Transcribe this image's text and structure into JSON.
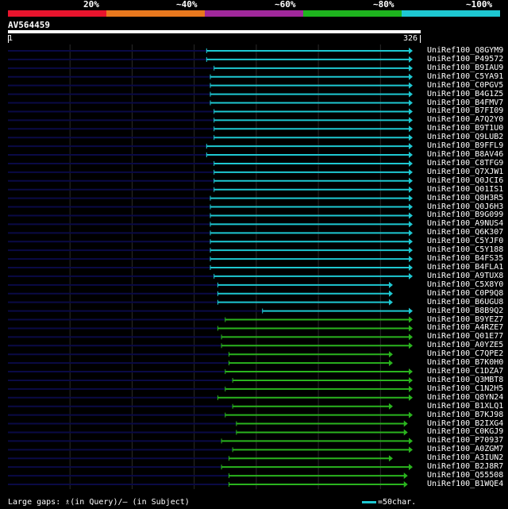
{
  "legend": {
    "segments": [
      {
        "color": "#e8142d",
        "label": "20%"
      },
      {
        "color": "#e8781e",
        "label": "~40%"
      },
      {
        "color": "#a0289b",
        "label": "~60%"
      },
      {
        "color": "#1eb41e",
        "label": "~80%"
      },
      {
        "color": "#1ec8d2",
        "label": "~100%"
      }
    ]
  },
  "query": {
    "name": "AV564459",
    "start": "1",
    "end": "326",
    "length": 326
  },
  "colors": {
    "cyan": "#1ec8d2",
    "green": "#2ab41e",
    "gap_line": "#0a0a46",
    "grid": "#2a2a2a"
  },
  "hits": [
    {
      "id": "UniRef100_Q8GYM9",
      "start": 160,
      "end": 326,
      "color": "cyan"
    },
    {
      "id": "UniRef100_P49572",
      "start": 160,
      "end": 326,
      "color": "cyan"
    },
    {
      "id": "UniRef100_B9IAU9",
      "start": 166,
      "end": 326,
      "color": "cyan"
    },
    {
      "id": "UniRef100_C5YA91",
      "start": 163,
      "end": 326,
      "color": "cyan"
    },
    {
      "id": "UniRef100_C0PGV5",
      "start": 163,
      "end": 326,
      "color": "cyan"
    },
    {
      "id": "UniRef100_B4G1Z5",
      "start": 163,
      "end": 326,
      "color": "cyan"
    },
    {
      "id": "UniRef100_B4FMV7",
      "start": 163,
      "end": 326,
      "color": "cyan"
    },
    {
      "id": "UniRef100_B7FI09",
      "start": 166,
      "end": 326,
      "color": "cyan"
    },
    {
      "id": "UniRef100_A7Q2Y0",
      "start": 166,
      "end": 326,
      "color": "cyan"
    },
    {
      "id": "UniRef100_B9T1U0",
      "start": 166,
      "end": 326,
      "color": "cyan"
    },
    {
      "id": "UniRef100_Q9LUB2",
      "start": 166,
      "end": 326,
      "color": "cyan"
    },
    {
      "id": "UniRef100_B9FFL9",
      "start": 160,
      "end": 326,
      "color": "cyan"
    },
    {
      "id": "UniRef100_B8AV46",
      "start": 160,
      "end": 326,
      "color": "cyan"
    },
    {
      "id": "UniRef100_C8TFG9",
      "start": 166,
      "end": 326,
      "color": "cyan"
    },
    {
      "id": "UniRef100_Q7XJW1",
      "start": 166,
      "end": 326,
      "color": "cyan"
    },
    {
      "id": "UniRef100_Q0JCI6",
      "start": 166,
      "end": 326,
      "color": "cyan"
    },
    {
      "id": "UniRef100_Q01IS1",
      "start": 166,
      "end": 326,
      "color": "cyan"
    },
    {
      "id": "UniRef100_Q8H3R5",
      "start": 163,
      "end": 326,
      "color": "cyan"
    },
    {
      "id": "UniRef100_Q0J6H3",
      "start": 163,
      "end": 326,
      "color": "cyan"
    },
    {
      "id": "UniRef100_B9G099",
      "start": 163,
      "end": 326,
      "color": "cyan"
    },
    {
      "id": "UniRef100_A9NUS4",
      "start": 163,
      "end": 326,
      "color": "cyan"
    },
    {
      "id": "UniRef100_Q6K307",
      "start": 163,
      "end": 326,
      "color": "cyan"
    },
    {
      "id": "UniRef100_C5YJF0",
      "start": 163,
      "end": 326,
      "color": "cyan"
    },
    {
      "id": "UniRef100_C5Y188",
      "start": 163,
      "end": 326,
      "color": "cyan"
    },
    {
      "id": "UniRef100_B4FS35",
      "start": 163,
      "end": 326,
      "color": "cyan"
    },
    {
      "id": "UniRef100_B4FLA1",
      "start": 163,
      "end": 326,
      "color": "cyan"
    },
    {
      "id": "UniRef100_A9TUX8",
      "start": 166,
      "end": 326,
      "color": "cyan"
    },
    {
      "id": "UniRef100_C5X8Y0",
      "start": 169,
      "end": 310,
      "color": "cyan"
    },
    {
      "id": "UniRef100_C0P9Q8",
      "start": 169,
      "end": 310,
      "color": "cyan"
    },
    {
      "id": "UniRef100_B6UGU8",
      "start": 169,
      "end": 310,
      "color": "cyan"
    },
    {
      "id": "UniRef100_B8B9Q2",
      "start": 205,
      "end": 326,
      "color": "cyan"
    },
    {
      "id": "UniRef100_B9YEZ7",
      "start": 175,
      "end": 326,
      "color": "green"
    },
    {
      "id": "UniRef100_A4RZE7",
      "start": 169,
      "end": 326,
      "color": "green"
    },
    {
      "id": "UniRef100_Q01E77",
      "start": 172,
      "end": 326,
      "color": "green"
    },
    {
      "id": "UniRef100_A0YZE5",
      "start": 172,
      "end": 326,
      "color": "green"
    },
    {
      "id": "UniRef100_C7QPE2",
      "start": 178,
      "end": 310,
      "color": "green"
    },
    {
      "id": "UniRef100_B7K0H0",
      "start": 178,
      "end": 310,
      "color": "green"
    },
    {
      "id": "UniRef100_C1DZA7",
      "start": 175,
      "end": 326,
      "color": "green"
    },
    {
      "id": "UniRef100_Q3MBT8",
      "start": 181,
      "end": 326,
      "color": "green"
    },
    {
      "id": "UniRef100_C1N2H5",
      "start": 175,
      "end": 326,
      "color": "green"
    },
    {
      "id": "UniRef100_Q8YN24",
      "start": 169,
      "end": 326,
      "color": "green"
    },
    {
      "id": "UniRef100_B1XLQ1",
      "start": 181,
      "end": 310,
      "color": "green"
    },
    {
      "id": "UniRef100_B7KJ98",
      "start": 175,
      "end": 326,
      "color": "green"
    },
    {
      "id": "UniRef100_B2IXG4",
      "start": 184,
      "end": 322,
      "color": "green"
    },
    {
      "id": "UniRef100_C0KGJ9",
      "start": 184,
      "end": 322,
      "color": "green"
    },
    {
      "id": "UniRef100_P70937",
      "start": 172,
      "end": 326,
      "color": "green"
    },
    {
      "id": "UniRef100_A0ZGM7",
      "start": 181,
      "end": 326,
      "color": "green"
    },
    {
      "id": "UniRef100_A3IUN2",
      "start": 178,
      "end": 310,
      "color": "green"
    },
    {
      "id": "UniRef100_B2J8R7",
      "start": 172,
      "end": 326,
      "color": "green"
    },
    {
      "id": "UniRef100_Q55508",
      "start": 178,
      "end": 322,
      "color": "green"
    },
    {
      "id": "UniRef100_B1WQE4",
      "start": 178,
      "end": 322,
      "color": "green"
    }
  ],
  "footer": {
    "gaps_text": "Large gaps: ♗(in Query)/― (in Subject)",
    "scale_text": "=50char."
  }
}
